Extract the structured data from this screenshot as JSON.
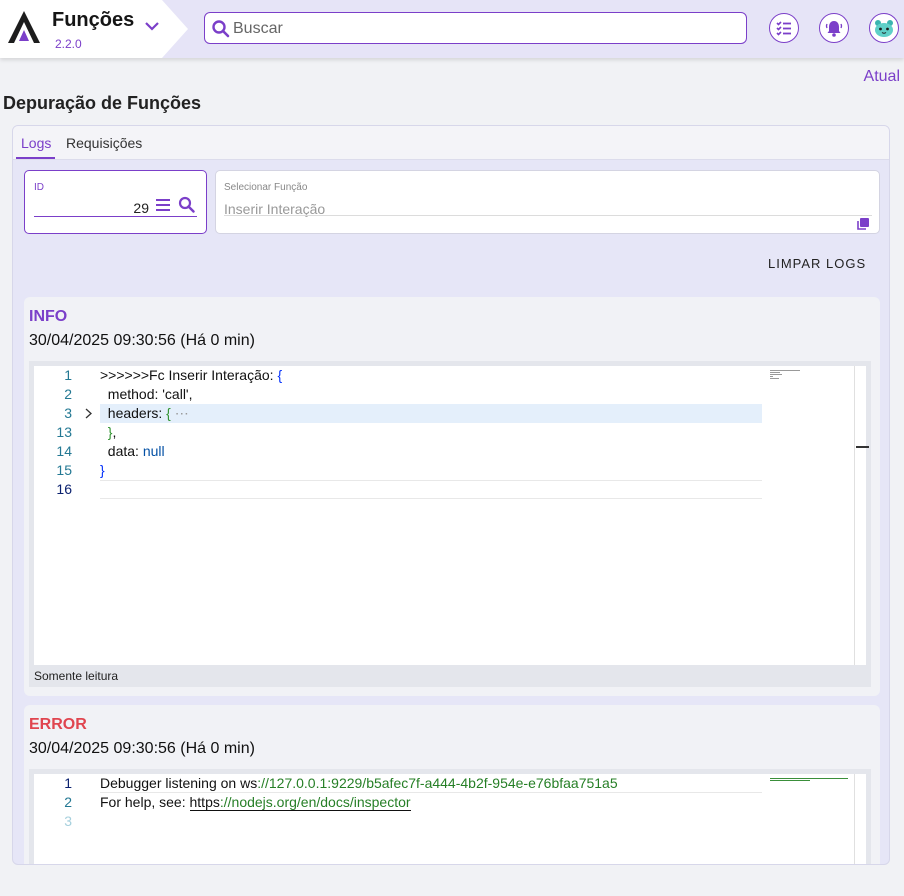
{
  "header": {
    "app_name": "Funções",
    "version": "2.2.0",
    "search_placeholder": "Buscar"
  },
  "atual_label": "Atual",
  "page_title": "Depuração de Funções",
  "tabs": [
    {
      "label": "Logs",
      "active": true
    },
    {
      "label": "Requisições",
      "active": false
    }
  ],
  "filters": {
    "id_label": "ID",
    "id_value": "29",
    "function_label": "Selecionar Função",
    "function_value": "Inserir Interação"
  },
  "clear_logs_label": "LIMPAR LOGS",
  "logs": [
    {
      "level": "INFO",
      "timestamp": "30/04/2025 09:30:56 (Há 0 min)",
      "read_only_label": "Somente leitura",
      "lines": [
        {
          "n": "1",
          "prefix": ">>>>>>Fc Inserir Interação: ",
          "open": "{"
        },
        {
          "n": "2",
          "text": "  method: 'call',"
        },
        {
          "n": "3",
          "key": "  headers: ",
          "open": "{",
          "ellipsis": " ⋯"
        },
        {
          "n": "13",
          "close": "  }",
          "comma": ","
        },
        {
          "n": "14",
          "key": "  data: ",
          "value": "null"
        },
        {
          "n": "15",
          "close": "}"
        },
        {
          "n": "16"
        }
      ]
    },
    {
      "level": "ERROR",
      "timestamp": "30/04/2025 09:30:56 (Há 0 min)",
      "lines": [
        {
          "n": "1",
          "prefix": "Debugger listening on ws",
          "link": "://127.0.0.1:9229/b5afec7f-a444-4b2f-954e-e76bfaa751a5"
        },
        {
          "n": "2",
          "prefix": "For help, see: ",
          "scheme": "https",
          "link": "://nodejs.org/en/docs/inspector"
        },
        {
          "n": "3"
        }
      ]
    }
  ],
  "colors": {
    "accent": "#7b3fc9",
    "error": "#e0454f"
  },
  "icons": [
    "logo-icon",
    "chevron-down-icon",
    "search-icon",
    "task-list-icon",
    "bell-icon",
    "avatar-icon",
    "list-icon",
    "magnifier-icon",
    "copy-icon",
    "fold-arrow-icon"
  ]
}
